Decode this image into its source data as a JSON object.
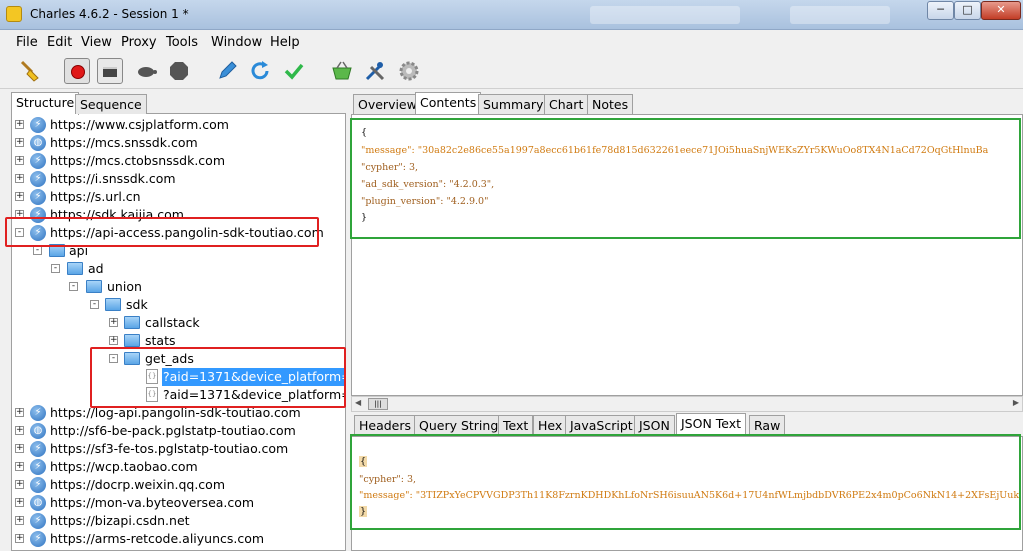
{
  "window": {
    "title": "Charles 4.6.2 - Session 1 *"
  },
  "window_controls": {
    "minimize": "─",
    "maximize": "□",
    "close": "✕"
  },
  "menu": [
    "File",
    "Edit",
    "View",
    "Proxy",
    "Tools",
    "Window",
    "Help"
  ],
  "toolbar": {
    "icons": [
      "broom-icon",
      "record-icon",
      "throttle-icon",
      "turtle-icon",
      "breakpoint-icon",
      "pen-icon",
      "refresh-icon",
      "check-icon",
      "basket-icon",
      "tools-icon",
      "gear-icon"
    ]
  },
  "left_tabs": [
    "Structure",
    "Sequence"
  ],
  "tree": [
    {
      "label": "https://www.csjplatform.com",
      "type": "host",
      "exp": "+"
    },
    {
      "label": "https://mcs.snssdk.com",
      "type": "host",
      "exp": "+"
    },
    {
      "label": "https://mcs.ctobsnssdk.com",
      "type": "host",
      "exp": "+"
    },
    {
      "label": "https://i.snssdk.com",
      "type": "host",
      "exp": "+"
    },
    {
      "label": "https://s.url.cn",
      "type": "host",
      "exp": "+"
    },
    {
      "label": "https://sdk.kaijia.com",
      "type": "host",
      "exp": "+"
    },
    {
      "label": "https://api-access.pangolin-sdk-toutiao.com",
      "type": "host",
      "exp": "-"
    },
    {
      "label": "api",
      "type": "folder",
      "exp": "-"
    },
    {
      "label": "ad",
      "type": "folder",
      "exp": "-"
    },
    {
      "label": "union",
      "type": "folder",
      "exp": "-"
    },
    {
      "label": "sdk",
      "type": "folder",
      "exp": "-"
    },
    {
      "label": "callstack",
      "type": "folder",
      "exp": "+"
    },
    {
      "label": "stats",
      "type": "folder",
      "exp": "+"
    },
    {
      "label": "get_ads",
      "type": "folder",
      "exp": "-"
    },
    {
      "label": "?aid=1371&device_platform=a",
      "type": "file",
      "exp": "",
      "selected": true
    },
    {
      "label": "?aid=1371&device_platform=a",
      "type": "file",
      "exp": ""
    },
    {
      "label": "https://log-api.pangolin-sdk-toutiao.com",
      "type": "host",
      "exp": "+"
    },
    {
      "label": "http://sf6-be-pack.pglstatp-toutiao.com",
      "type": "host",
      "exp": "+"
    },
    {
      "label": "https://sf3-fe-tos.pglstatp-toutiao.com",
      "type": "host",
      "exp": "+"
    },
    {
      "label": "https://wcp.taobao.com",
      "type": "host",
      "exp": "+"
    },
    {
      "label": "https://docrp.weixin.qq.com",
      "type": "host",
      "exp": "+"
    },
    {
      "label": "https://mon-va.byteoversea.com",
      "type": "host",
      "exp": "+"
    },
    {
      "label": "https://bizapi.csdn.net",
      "type": "host",
      "exp": "+"
    },
    {
      "label": "https://arms-retcode.aliyuncs.com",
      "type": "host",
      "exp": "+"
    }
  ],
  "right_tabs": [
    "Overview",
    "Contents",
    "Summary",
    "Chart",
    "Notes"
  ],
  "request_json": [
    "{",
    "    \"message\": \"30a82c2e86ce55a1997a8ecc61b61fe78d815d632261eece71JOi5huaSnjWEKsZYr5KWuOo8TX4N1aCd72OqGtHlnuBa",
    "    \"cypher\": 3,",
    "    \"ad_sdk_version\": \"4.2.0.3\",",
    "    \"plugin_version\": \"4.2.9.0\"",
    "}"
  ],
  "response_tabs": [
    "Headers",
    "Query String",
    "Text",
    "Hex",
    "JavaScript",
    "JSON",
    "JSON Text",
    "Raw"
  ],
  "response_json": [
    "{",
    "    \"cypher\": 3,",
    "    \"message\": \"3TIZPxYeCPVVGDP3Th11K8FzrnKDHDKhLfoNrSH6isuuAN5K6d+17U4nfWLmjbdbDVR6PE2x4m0pCo6NkN14+2XFsEjUuk",
    "}"
  ],
  "scroll_thumb": "|||"
}
